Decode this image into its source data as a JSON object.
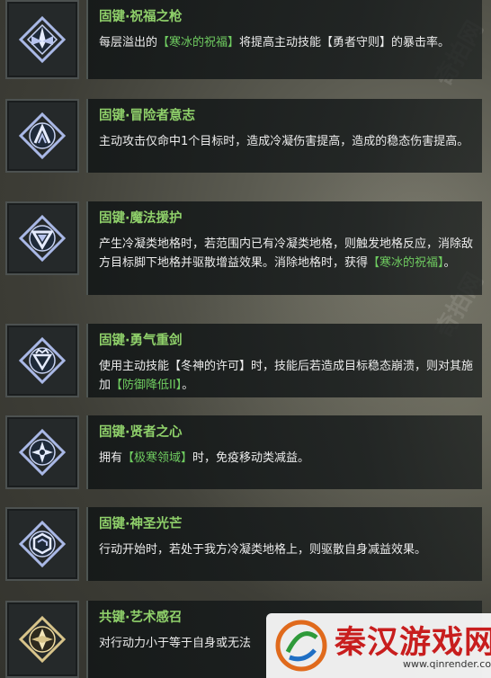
{
  "watermarks": [
    "奇拍网",
    "奇拍网"
  ],
  "skills": [
    {
      "icon": "crystal-sun-icon",
      "title": "固键·祝福之枪",
      "desc": [
        "每层溢出的",
        "【寒冰的祝福】",
        "将提高主动技能【勇者守则】的暴击率。"
      ]
    },
    {
      "icon": "triple-arch-icon",
      "title": "固键·冒险者意志",
      "desc": [
        "主动攻击仅命中1个目标时，造成冷凝伤害提高，造成的稳态伤害提高。"
      ]
    },
    {
      "icon": "triangle-knot-icon",
      "title": "固键·魔法援护",
      "desc": [
        "产生冷凝类地格时，若范围内已有冷凝类地格，则触发地格反应，消除敌方目标脚下地格并驱散增益效果。消除地格时，获得",
        "【寒冰的祝福】",
        "。"
      ]
    },
    {
      "icon": "crown-triangle-icon",
      "title": "固键·勇气重剑",
      "desc": [
        "使用主动技能【冬神的许可】时，技能后若造成目标稳态崩溃，则对其施加",
        "【防御降低II】",
        "。"
      ]
    },
    {
      "icon": "star-knot-icon",
      "title": "固键·贤者之心",
      "desc": [
        "拥有",
        "【极寒领域】",
        "时，免疫移动类减益。"
      ]
    },
    {
      "icon": "hex-link-icon",
      "title": "固键·神圣光芒",
      "desc": [
        "行动开始时，若处于我方冷凝类地格上，则驱散自身减益效果。"
      ]
    },
    {
      "icon": "gold-crystal-icon",
      "title": "共键·艺术感召",
      "desc": [
        "对行动力小于等于自身或无法"
      ]
    }
  ],
  "logo": {
    "text": "秦汉游戏网",
    "url": "www.qinrender.com"
  }
}
